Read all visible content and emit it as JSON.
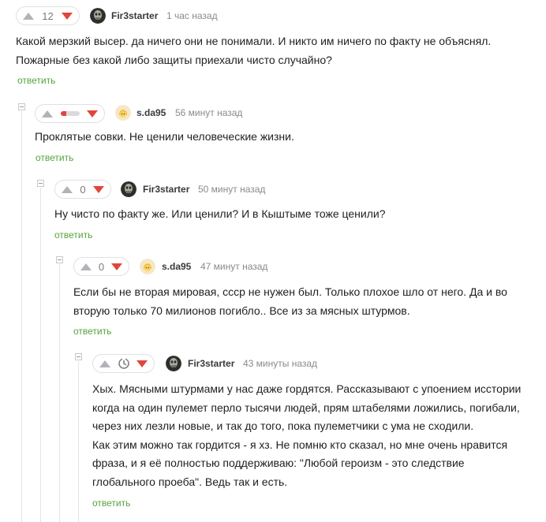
{
  "comments": [
    {
      "rating": "12",
      "author": "Fir3starter",
      "time": "1 час назад",
      "lines": [
        "Какой мерзкий высер. да ничего они не понимали. И никто им ничего по факту не объяснял.",
        "Пожарные без какой либо защиты приехали чисто случайно?"
      ],
      "reply": "ответить"
    },
    {
      "rating_fraction": 0.3,
      "author": "s.da95",
      "time": "56 минут назад",
      "lines": [
        "Проклятые совки. Не ценили человеческие жизни."
      ],
      "reply": "ответить"
    },
    {
      "rating": "0",
      "author": "Fir3starter",
      "time": "50 минут назад",
      "lines": [
        "Ну чисто по факту же. Или ценили? И в Кыштыме тоже ценили?"
      ],
      "reply": "ответить"
    },
    {
      "rating": "0",
      "author": "s.da95",
      "time": "47 минут назад",
      "lines": [
        "Если бы не вторая мировая, ссср не нужен был. Только плохое шло от него. Да и во",
        "вторую только 70 милионов погибло.. Все из за мясных штурмов."
      ],
      "reply": "ответить"
    },
    {
      "rating_icon": "clock-icon",
      "author": "Fir3starter",
      "time": "43 минуты назад",
      "lines": [
        "Хых. Мясными штурмами у нас даже гордятся. Рассказывают с упоением исстории",
        "когда на один пулемет перло тысячи людей, прям штабелями ложились, погибали,",
        "через них лезли новые, и так до того, пока пулеметчики с ума не сходили.",
        "Как этим можно так гордится - я хз. Не помню кто сказал, но мне очень нравится",
        "фраза, и я её полностью поддерживаю: \"Любой героизм - это следствие",
        "глобального проеба\". Ведь так и есть."
      ],
      "reply": "ответить"
    }
  ],
  "colors": {
    "accent_green": "#56a33e",
    "downvote_red": "#e2453a",
    "upvote_grey": "#b0b4b8"
  }
}
